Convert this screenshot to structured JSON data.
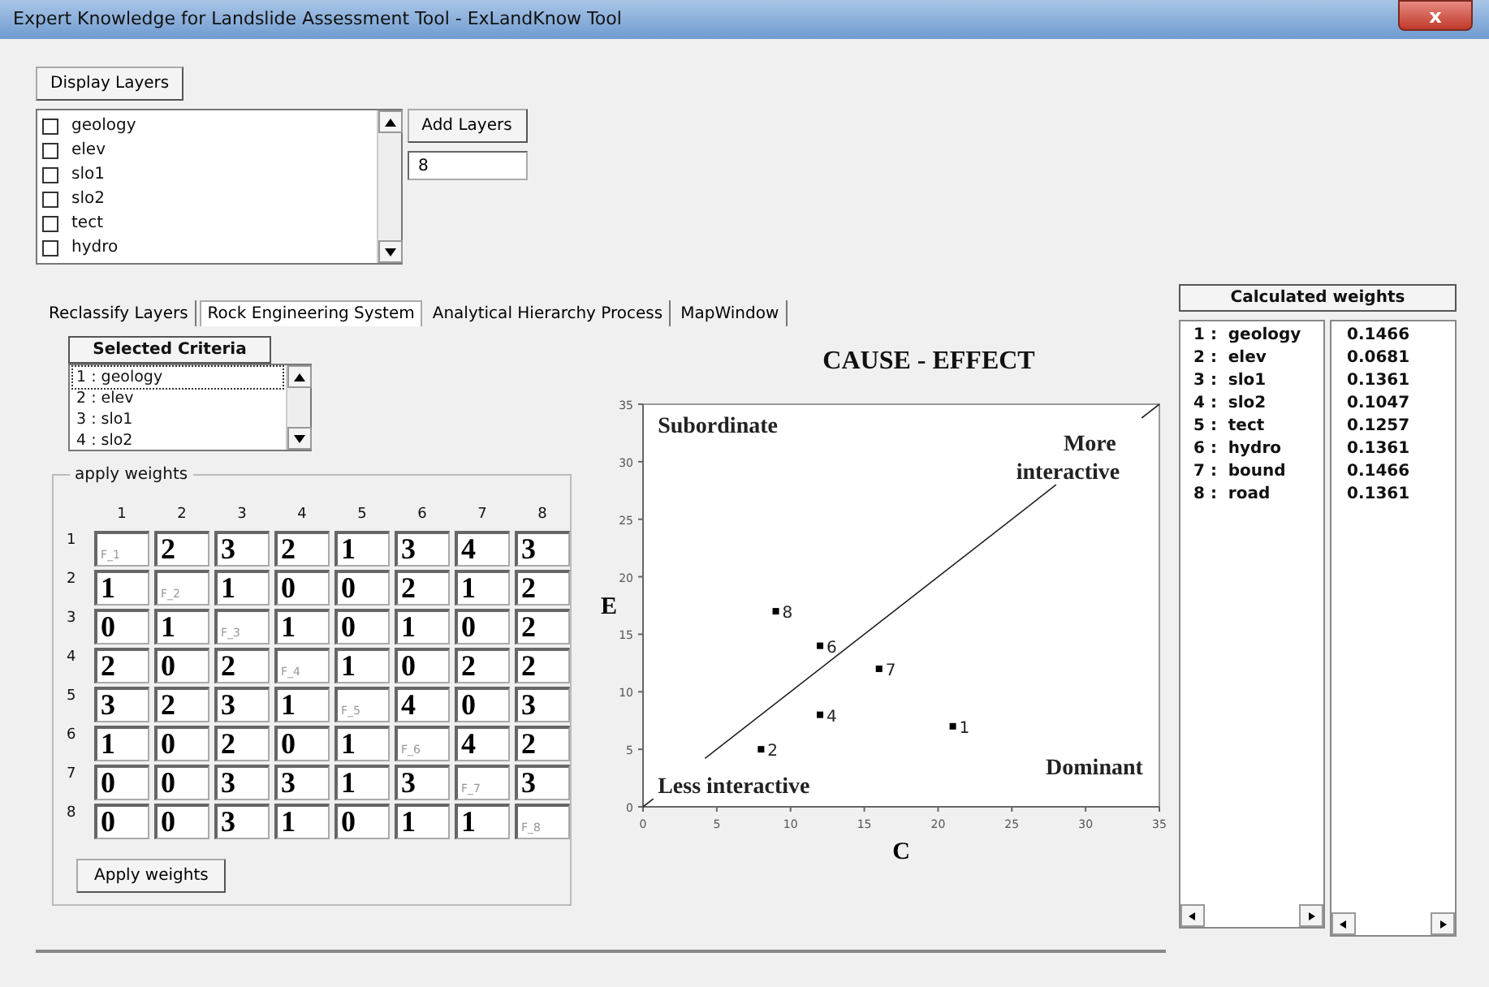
{
  "window": {
    "title": "Expert Knowledge for Landslide Assessment Tool - ExLandKnow Tool",
    "close_glyph": "x"
  },
  "display_button": "Display Layers",
  "layers": [
    {
      "label": "geology",
      "checked": false
    },
    {
      "label": "elev",
      "checked": false
    },
    {
      "label": "slo1",
      "checked": false
    },
    {
      "label": "slo2",
      "checked": false
    },
    {
      "label": "tect",
      "checked": false
    },
    {
      "label": "hydro",
      "checked": false
    }
  ],
  "add_button": "Add Layers",
  "layer_count": {
    "value": "8"
  },
  "tabs": [
    {
      "label": "Reclassify Layers",
      "selected": false
    },
    {
      "label": "Rock Engineering System",
      "selected": true
    },
    {
      "label": "Analytical Hierarchy Process",
      "selected": false
    },
    {
      "label": "MapWindow",
      "selected": false
    }
  ],
  "criteria": {
    "header": "Selected Criteria",
    "items": [
      {
        "label": "1 : geology",
        "selected": true
      },
      {
        "label": "2 : elev",
        "selected": false
      },
      {
        "label": "3 : slo1",
        "selected": false
      },
      {
        "label": "4 : slo2",
        "selected": false
      }
    ]
  },
  "weights_group": {
    "title": "apply weights",
    "column_headers": [
      "1",
      "2",
      "3",
      "4",
      "5",
      "6",
      "7",
      "8"
    ],
    "rows": [
      {
        "label": "1",
        "cells": [
          {
            "placeholder": "F_1"
          },
          {
            "value": "2"
          },
          {
            "value": "3"
          },
          {
            "value": "2"
          },
          {
            "value": "1"
          },
          {
            "value": "3"
          },
          {
            "value": "4"
          },
          {
            "value": "3"
          }
        ]
      },
      {
        "label": "2",
        "cells": [
          {
            "value": "1"
          },
          {
            "placeholder": "F_2"
          },
          {
            "value": "1"
          },
          {
            "value": "0"
          },
          {
            "value": "0"
          },
          {
            "value": "2"
          },
          {
            "value": "1"
          },
          {
            "value": "2"
          }
        ]
      },
      {
        "label": "3",
        "cells": [
          {
            "value": "0"
          },
          {
            "value": "1"
          },
          {
            "placeholder": "F_3"
          },
          {
            "value": "1"
          },
          {
            "value": "0"
          },
          {
            "value": "1"
          },
          {
            "value": "0"
          },
          {
            "value": "2"
          }
        ]
      },
      {
        "label": "4",
        "cells": [
          {
            "value": "2"
          },
          {
            "value": "0"
          },
          {
            "value": "2"
          },
          {
            "placeholder": "F_4"
          },
          {
            "value": "1"
          },
          {
            "value": "0"
          },
          {
            "value": "2"
          },
          {
            "value": "2"
          }
        ]
      },
      {
        "label": "5",
        "cells": [
          {
            "value": "3"
          },
          {
            "value": "2"
          },
          {
            "value": "3"
          },
          {
            "value": "1"
          },
          {
            "placeholder": "F_5"
          },
          {
            "value": "4"
          },
          {
            "value": "0"
          },
          {
            "value": "3"
          }
        ]
      },
      {
        "label": "6",
        "cells": [
          {
            "value": "1"
          },
          {
            "value": "0"
          },
          {
            "value": "2"
          },
          {
            "value": "0"
          },
          {
            "value": "1"
          },
          {
            "placeholder": "F_6"
          },
          {
            "value": "4"
          },
          {
            "value": "2"
          }
        ]
      },
      {
        "label": "7",
        "cells": [
          {
            "value": "0"
          },
          {
            "value": "0"
          },
          {
            "value": "3"
          },
          {
            "value": "3"
          },
          {
            "value": "1"
          },
          {
            "value": "3"
          },
          {
            "placeholder": "F_7"
          },
          {
            "value": "3"
          }
        ]
      },
      {
        "label": "8",
        "cells": [
          {
            "value": "0"
          },
          {
            "value": "0"
          },
          {
            "value": "3"
          },
          {
            "value": "1"
          },
          {
            "value": "0"
          },
          {
            "value": "1"
          },
          {
            "value": "1"
          },
          {
            "placeholder": "F_8"
          }
        ]
      }
    ],
    "button": "Apply weights"
  },
  "chart": {
    "chart_data": {
      "type": "scatter",
      "title": "CAUSE - EFFECT",
      "xlabel": "C",
      "ylabel": "E",
      "x": [
        21,
        8,
        12,
        12,
        16,
        9
      ],
      "series": [
        {
          "color": "#000000",
          "values": [
            7,
            5,
            8,
            14,
            12,
            17
          ]
        }
      ],
      "value_labels": [
        "1",
        "2",
        "4",
        "6",
        "7",
        "8"
      ],
      "xlim": [
        0,
        35
      ],
      "ylim": [
        0,
        35
      ],
      "xticks": [
        {
          "value": 0,
          "label": "0"
        },
        {
          "value": 5,
          "label": "5"
        },
        {
          "value": 10,
          "label": "10"
        },
        {
          "value": 15,
          "label": "15"
        },
        {
          "value": 20,
          "label": "20"
        },
        {
          "value": 25,
          "label": "25"
        },
        {
          "value": 30,
          "label": "30"
        },
        {
          "value": 35,
          "label": "35"
        }
      ],
      "yticks": [
        {
          "value": 0,
          "label": "0"
        },
        {
          "value": 5,
          "label": "5"
        },
        {
          "value": 10,
          "label": "10"
        },
        {
          "value": 15,
          "label": "15"
        },
        {
          "value": 20,
          "label": "20"
        },
        {
          "value": 25,
          "label": "25"
        },
        {
          "value": 30,
          "label": "30"
        },
        {
          "value": 35,
          "label": "35"
        }
      ],
      "annotations": [
        "Subordinate",
        "More",
        "interactive",
        "Less interactive",
        "Dominant"
      ]
    }
  },
  "calculated": {
    "header": "Calculated weights",
    "names": [
      "1 :  geology",
      "2 :  elev",
      "3 :  slo1",
      "4 :  slo2",
      "5 :  tect",
      "6 :  hydro",
      "7 :  bound",
      "8 :  road"
    ],
    "values": [
      "0.1466",
      "0.0681",
      "0.1361",
      "0.1047",
      "0.1257",
      "0.1361",
      "0.1466",
      "0.1361"
    ]
  }
}
